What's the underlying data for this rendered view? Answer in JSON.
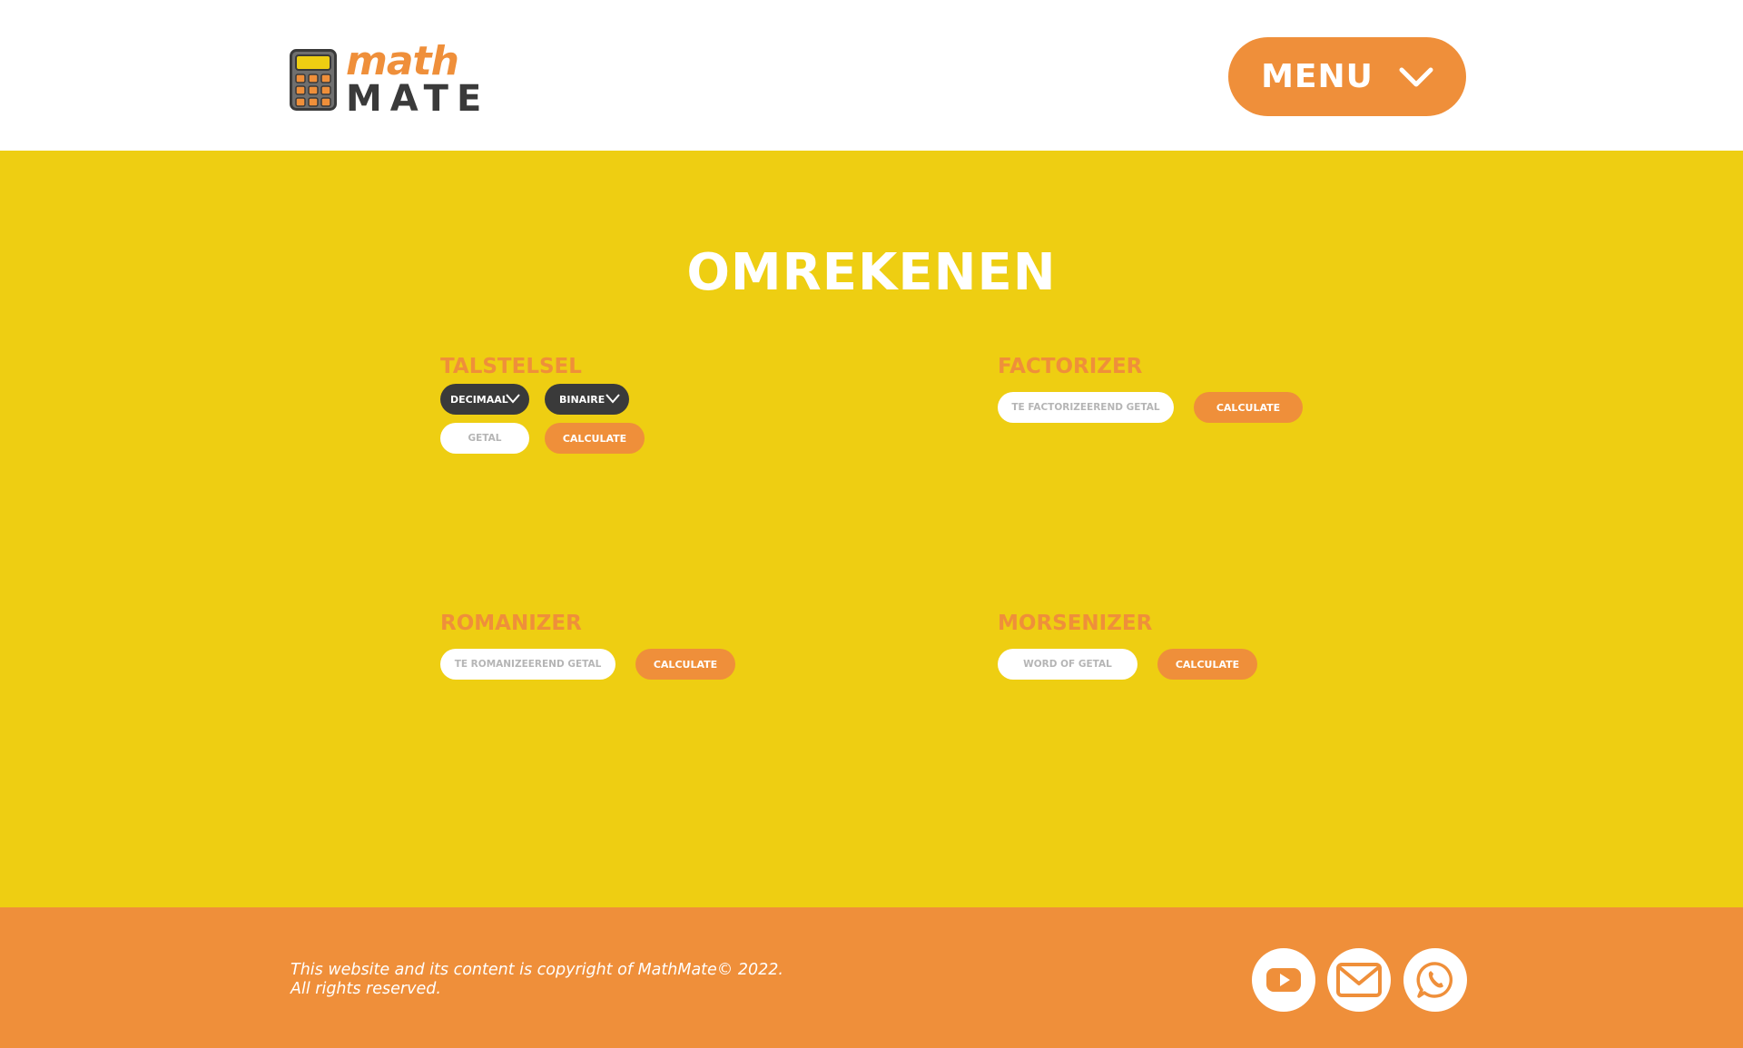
{
  "header": {
    "logo": {
      "word_top": "math",
      "word_bottom": "MATE"
    },
    "menu_label": "MENU"
  },
  "colors": {
    "accent": "#ef8f3a",
    "background": "#eece12",
    "dark": "#3a3a3a",
    "text_light": "#ffffff"
  },
  "main": {
    "title": "OMREKENEN",
    "talstelsel": {
      "title": "TALSTELSEL",
      "from_select": "DECIMAAL",
      "to_select": "BINAIRE",
      "input_placeholder": "GETAL",
      "calculate_label": "CALCULATE"
    },
    "factorizer": {
      "title": "FACTORIZER",
      "input_placeholder": "TE FACTORIZEEREND GETAL",
      "calculate_label": "CALCULATE"
    },
    "romanizer": {
      "title": "ROMANIZER",
      "input_placeholder": "TE ROMANIZEEREND GETAL",
      "calculate_label": "CALCULATE"
    },
    "morsenizer": {
      "title": "MORSENIZER",
      "input_placeholder": "WORD OF GETAL",
      "calculate_label": "CALCULATE"
    }
  },
  "footer": {
    "copyright_line1": "This website and its content is copyright of MathMate© 2022.",
    "copyright_line2": "All rights reserved.",
    "social_icons": [
      "youtube-icon",
      "mail-icon",
      "whatsapp-icon"
    ]
  }
}
